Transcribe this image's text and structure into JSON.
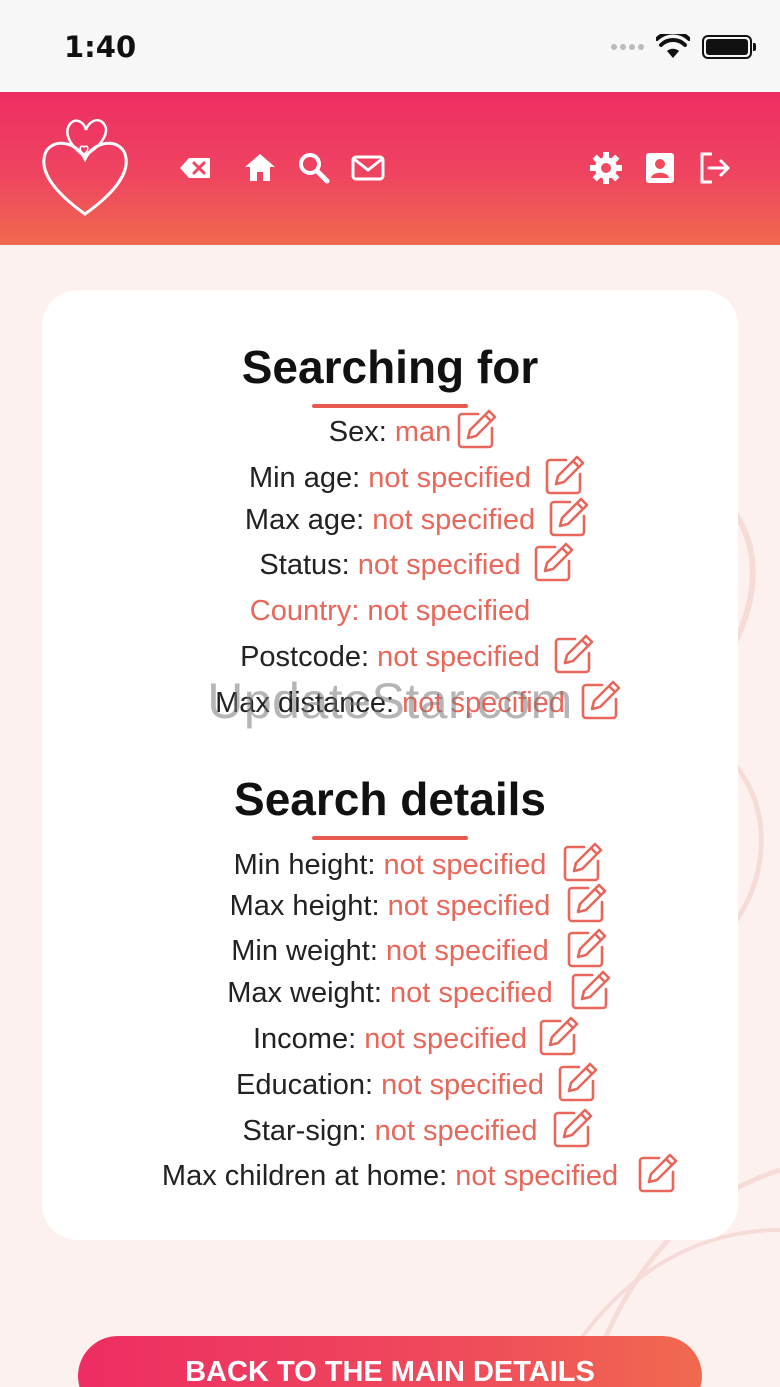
{
  "status_bar": {
    "time": "1:40"
  },
  "header": {
    "icons": [
      "logo-hearts",
      "backspace-icon",
      "home-icon",
      "search-icon",
      "mail-icon",
      "settings-icon",
      "profile-icon",
      "logout-icon"
    ]
  },
  "searching_for": {
    "title": "Searching for",
    "rows": [
      {
        "label": "Sex: ",
        "value": "man",
        "editable": true
      },
      {
        "label": "Min age: ",
        "value": "not specified",
        "editable": true
      },
      {
        "label": "Max age: ",
        "value": "not specified",
        "editable": true
      },
      {
        "label": "Status: ",
        "value": "not specified",
        "editable": true
      },
      {
        "label": "Country: not specified",
        "value": "",
        "editable": false
      },
      {
        "label": "Postcode: ",
        "value": "not specified",
        "editable": true
      },
      {
        "label": "Max distance: ",
        "value": "not specified",
        "editable": true
      }
    ]
  },
  "search_details": {
    "title": "Search details",
    "rows": [
      {
        "label": "Min height: ",
        "value": "not specified"
      },
      {
        "label": "Max height: ",
        "value": "not specified"
      },
      {
        "label": "Min weight: ",
        "value": "not specified"
      },
      {
        "label": "Max weight: ",
        "value": "not specified"
      },
      {
        "label": "Income: ",
        "value": "not specified"
      },
      {
        "label": "Education: ",
        "value": "not specified"
      },
      {
        "label": "Star-sign: ",
        "value": "not specified"
      },
      {
        "label": "Max children at home: ",
        "value": "not specified"
      }
    ]
  },
  "watermark": "UpdateStar.com",
  "back_button_label": "BACK TO THE MAIN DETAILS",
  "colors": {
    "accent": "#e8665a",
    "header_start": "#ee2d63",
    "header_end": "#f06a4e"
  }
}
